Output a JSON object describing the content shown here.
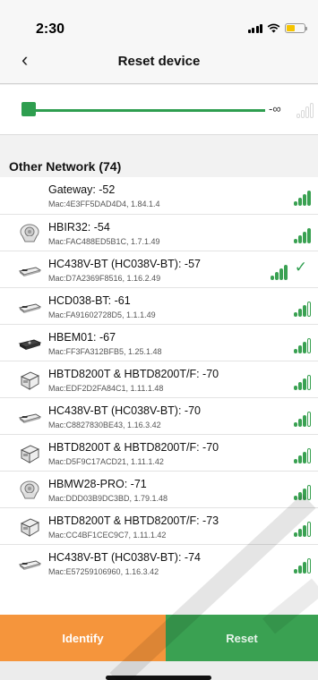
{
  "status_bar": {
    "time": "2:30"
  },
  "nav": {
    "back_glyph": "‹",
    "title": "Reset device"
  },
  "slider": {
    "value_label": "-∞"
  },
  "section": {
    "title": "Other Network (74)"
  },
  "devices": [
    {
      "name": "Gateway: -52",
      "mac": "Mac:4E3FF5DAD4D4, 1.84.1.4",
      "icon": "none",
      "signal": 4,
      "selected": false
    },
    {
      "name": "HBIR32: -54",
      "mac": "Mac:FAC488ED5B1C, 1.7.1.49",
      "icon": "round-sensor-icon",
      "signal": 4,
      "selected": false
    },
    {
      "name": "HC438V-BT (HC038V-BT): -57",
      "mac": "Mac:D7A2369F8516, 1.16.2.49",
      "icon": "flat-module-icon",
      "signal": 4,
      "selected": true
    },
    {
      "name": "HCD038-BT: -61",
      "mac": "Mac:FA91602728D5, 1.1.1.49",
      "icon": "flat-module-icon",
      "signal": 3,
      "selected": false
    },
    {
      "name": "HBEM01: -67",
      "mac": "Mac:FF3FA312BFB5, 1.25.1.48",
      "icon": "dark-module-icon",
      "signal": 3,
      "selected": false
    },
    {
      "name": "HBTD8200T & HBTD8200T/F: -70",
      "mac": "Mac:EDF2D2FA84C1, 1.11.1.48",
      "icon": "box-device-icon",
      "signal": 3,
      "selected": false
    },
    {
      "name": "HC438V-BT (HC038V-BT): -70",
      "mac": "Mac:C8827830BE43, 1.16.3.42",
      "icon": "flat-module-icon",
      "signal": 3,
      "selected": false
    },
    {
      "name": "HBTD8200T & HBTD8200T/F: -70",
      "mac": "Mac:D5F9C17ACD21, 1.11.1.42",
      "icon": "box-device-icon",
      "signal": 3,
      "selected": false
    },
    {
      "name": "HBMW28-PRO: -71",
      "mac": "Mac:DDD03B9DC3BD, 1.79.1.48",
      "icon": "round-sensor-icon",
      "signal": 3,
      "selected": false
    },
    {
      "name": "HBTD8200T & HBTD8200T/F: -73",
      "mac": "Mac:CC4BF1CEC9C7, 1.11.1.42",
      "icon": "box-device-icon",
      "signal": 3,
      "selected": false
    },
    {
      "name": "HC438V-BT (HC038V-BT): -74",
      "mac": "Mac:E57259106960, 1.16.3.42",
      "icon": "flat-module-icon",
      "signal": 3,
      "selected": false
    }
  ],
  "actions": {
    "identify_label": "Identify",
    "reset_label": "Reset"
  },
  "colors": {
    "accent_green": "#3aa152",
    "accent_orange": "#f5953c"
  }
}
